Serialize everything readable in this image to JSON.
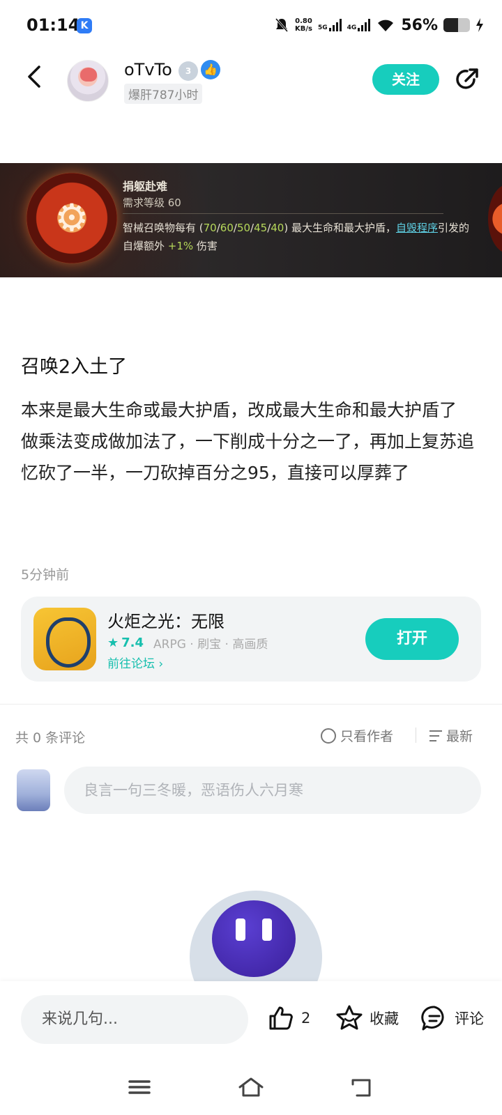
{
  "status_bar": {
    "time": "01:14",
    "k_badge": "K",
    "speed_value": "0.80",
    "speed_unit": "KB/s",
    "sig1_label": "5G",
    "sig2_label": "4G",
    "battery_text": "56%",
    "battery_level": 0.56
  },
  "header": {
    "username": "oTvTo",
    "level_badge": "3",
    "hours_tag": "爆肝787小时",
    "follow_label": "关注"
  },
  "banner": {
    "skill_name": "捐躯赴难",
    "skill_req": "需求等级 60",
    "desc_a": "智械召唤物每有 (",
    "v1": "70",
    "s1": "/",
    "v2": "60",
    "s2": "/",
    "v3": "50",
    "s3": "/",
    "v4": "45",
    "s4": "/",
    "v5": "40",
    "desc_b": ") 最大生命和最大护盾，",
    "link": "自毁程序",
    "desc_c": "引发的自爆额外 ",
    "bonus": "+1%",
    "desc_d": " 伤害"
  },
  "post": {
    "title": "召唤2入土了",
    "body_line1": "本来是最大生命或最大护盾，改成最大生命和最大护盾了",
    "body_line2": "做乘法变成做加法了，一下削成十分之一了，再加上复苏追忆砍了一半，一刀砍掉百分之95，直接可以厚葬了",
    "time": "5分钟前"
  },
  "game_card": {
    "name": "火炬之光：无限",
    "star": "★",
    "score": "7.4",
    "tags": "ARPG · 刷宝 · 高画质",
    "forum_link": "前往论坛 ›",
    "open_label": "打开"
  },
  "comments": {
    "count_label": "共 0 条评论",
    "author_only_label": "只看作者",
    "sort_label": "最新",
    "input_placeholder": "良言一句三冬暖，恶语伤人六月寒"
  },
  "bottom_bar": {
    "say_placeholder": "来说几句...",
    "like_count": "2",
    "fav_label": "收藏",
    "comment_label": "评论"
  },
  "colors": {
    "accent": "#17cdbd",
    "verify": "#2f8cf0"
  }
}
